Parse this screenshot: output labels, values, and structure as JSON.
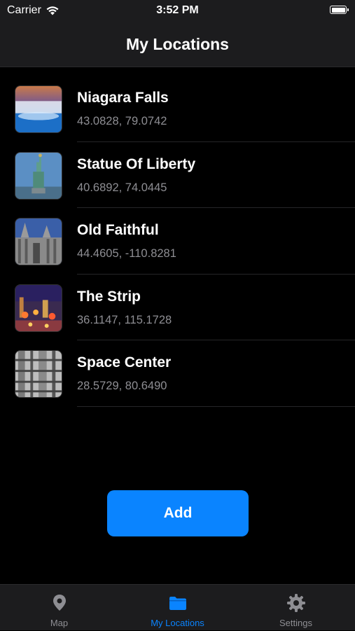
{
  "status": {
    "carrier": "Carrier",
    "time": "3:52 PM"
  },
  "nav": {
    "title": "My Locations"
  },
  "locations": [
    {
      "name": "Niagara Falls",
      "coords": "43.0828, 79.0742"
    },
    {
      "name": "Statue Of Liberty",
      "coords": "40.6892, 74.0445"
    },
    {
      "name": "Old Faithful",
      "coords": "44.4605, -110.8281"
    },
    {
      "name": "The Strip",
      "coords": "36.1147, 115.1728"
    },
    {
      "name": "Space Center",
      "coords": "28.5729, 80.6490"
    }
  ],
  "add_button": {
    "label": "Add"
  },
  "tabs": [
    {
      "label": "Map",
      "icon": "map-pin-icon",
      "selected": false
    },
    {
      "label": "My Locations",
      "icon": "folder-icon",
      "selected": true
    },
    {
      "label": "Settings",
      "icon": "gear-icon",
      "selected": false
    }
  ],
  "colors": {
    "accent": "#0a84ff",
    "background": "#000000",
    "bar_background": "#1c1c1e",
    "secondary_text": "#8e8e93"
  }
}
